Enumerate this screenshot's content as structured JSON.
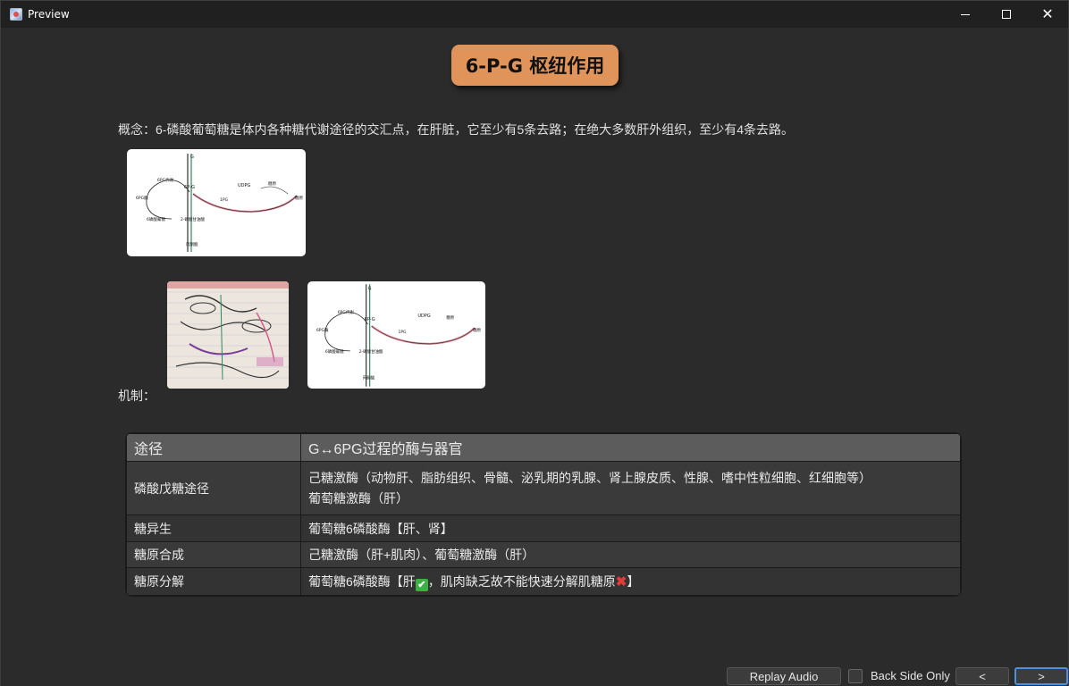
{
  "window": {
    "title": "Preview",
    "minimize_symbol": "",
    "close_symbol": "✕"
  },
  "card": {
    "title": "6-P-G 枢纽作用",
    "concept": "概念：6-磷酸葡萄糖是体内各种糖代谢途径的交汇点，在肝脏，它至少有5条去路；在绝大多数肝外组织，至少有4条去路。",
    "mechanism_label": "机制：",
    "diagram": {
      "top": "G",
      "center": "6P-G",
      "left_top": "6PG代谢",
      "left": "6PG酶",
      "left_bottom": "6磷酸葡糖",
      "right": "UDPG",
      "right_far": "糖原",
      "right_mid": "1PG",
      "bottom": "丙酮酸",
      "bottom_mid": "2-磷酸甘油酸"
    },
    "table": {
      "headers": [
        "途径",
        "G↔6PG过程的酶与器官"
      ],
      "rows": [
        {
          "path": "磷酸戊糖途径",
          "line1": "己糖激酶（动物肝、脂肪组织、骨髓、泌乳期的乳腺、肾上腺皮质、性腺、嗜中性粒细胞、红细胞等）",
          "line2": "葡萄糖激酶（肝）"
        },
        {
          "path": "糖异生",
          "line1": "葡萄糖6磷酸酶【肝、肾】"
        },
        {
          "path": "糖原合成",
          "line1": "己糖激酶（肝+肌肉）、葡萄糖激酶（肝）"
        },
        {
          "path": "糖原分解",
          "part1": "葡萄糖6磷酸酶【肝",
          "check": "✔",
          "part2": "，肌肉缺乏故不能快速分解肌糖原",
          "cross": "✖",
          "part3": "】"
        }
      ]
    }
  },
  "footer": {
    "replay_label": "Replay Audio",
    "back_side_label": "Back Side Only",
    "prev_label": "<",
    "next_label": ">"
  }
}
